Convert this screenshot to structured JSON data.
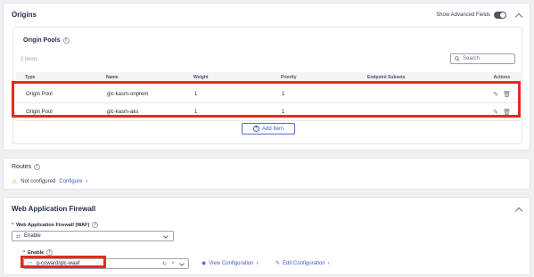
{
  "origins": {
    "title": "Origins",
    "advanced_fields_label": "Show Advanced Fields",
    "pools": {
      "title": "Origin Pools",
      "items_count": "2 items",
      "search_placeholder": "Search",
      "columns": [
        "Type",
        "Name",
        "Weight",
        "Priority",
        "Endpoint Subsets",
        "Actions"
      ],
      "rows": [
        {
          "type": "Origin Pool",
          "name": "glc-kasm-onprem",
          "weight": "1",
          "priority": "1",
          "endpoint_subsets": ""
        },
        {
          "type": "Origin Pool",
          "name": "glc-kasm-aks",
          "weight": "1",
          "priority": "1",
          "endpoint_subsets": ""
        }
      ],
      "add_item_label": "Add Item"
    }
  },
  "routes": {
    "title": "Routes",
    "status_text": "Not configured",
    "configure_link": "Configure"
  },
  "waf": {
    "title": "Web Application Firewall",
    "field_label": "Web Application Firewall (WAF)",
    "select_value": "Enable",
    "enable_label": "Enable",
    "enable_value": "g-coward/glc-waaf",
    "view_configuration": "View Configuration",
    "edit_configuration": "Edit Configuration"
  },
  "colors": {
    "highlight": "#e8291c",
    "accent": "#3f5cc8",
    "warning": "#e3a008"
  }
}
